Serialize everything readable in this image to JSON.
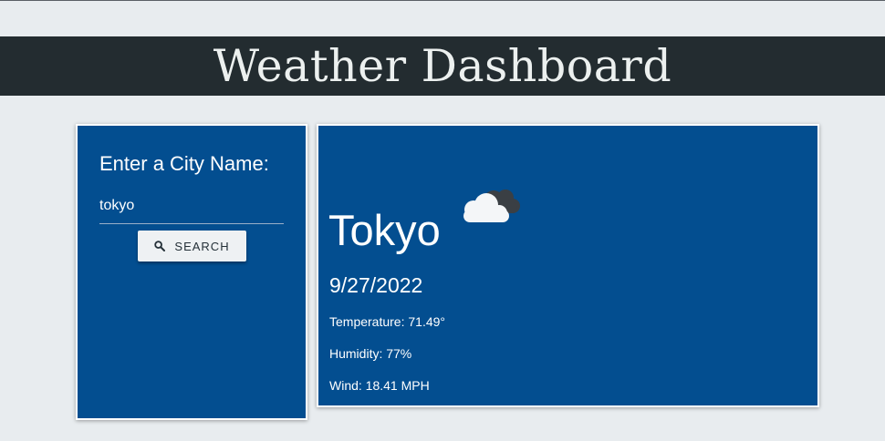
{
  "header": {
    "title": "Weather Dashboard"
  },
  "search": {
    "prompt": "Enter a City Name:",
    "input_value": "tokyo",
    "button_label": "SEARCH",
    "button_icon": "search-icon"
  },
  "current": {
    "city": "Tokyo",
    "weather_icon": "broken-clouds-icon",
    "date": "9/27/2022",
    "temperature": "Temperature: 71.49°",
    "humidity": "Humidity: 77%",
    "wind": "Wind: 18.41 MPH"
  },
  "colors": {
    "page_bg": "#e8ecef",
    "header_bg": "#232c30",
    "panel_bg": "#034e90",
    "button_bg": "#eef1f3"
  }
}
